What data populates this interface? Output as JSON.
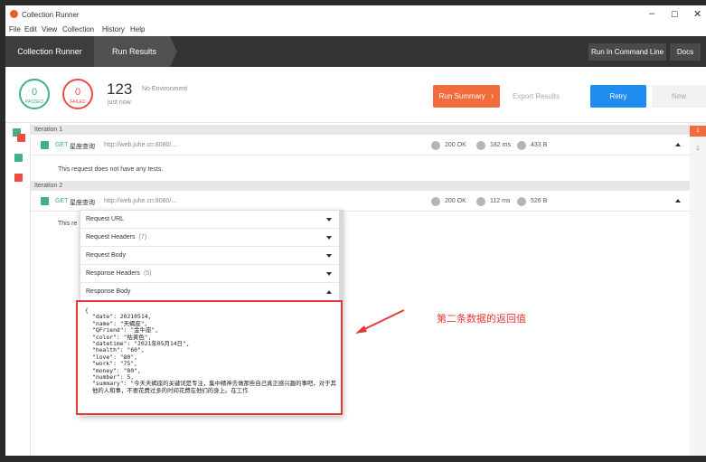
{
  "window": {
    "title": "Collection Runner",
    "controls": {
      "minimize": "–",
      "maximize": "☐",
      "close": "✕"
    }
  },
  "menu": [
    "File",
    "Edit",
    "View",
    "Collection",
    "History",
    "Help"
  ],
  "tabs": {
    "runner": "Collection Runner",
    "results": "Run Results"
  },
  "toolbar": {
    "command_line": "Run In Command Line",
    "docs": "Docs"
  },
  "summary": {
    "passed_count": "0",
    "passed_label": "PASSED",
    "failed_count": "0",
    "failed_label": "FAILED",
    "total": "123",
    "when": "just now",
    "environment": "No Environment",
    "run_summary": "Run Summary",
    "export": "Export Results",
    "retry": "Retry",
    "new": "New"
  },
  "iterations": [
    {
      "header": "Iteration 1",
      "method": "GET",
      "name": "星座查询",
      "url": "http://web.juhe.cn:8080/...",
      "status": "200 OK",
      "time": "182 ms",
      "size": "433 B",
      "note": "This request does not have any tests."
    },
    {
      "header": "Iteration 2",
      "method": "GET",
      "name": "星座查询",
      "url": "http://web.juhe.cn:8080/...",
      "status": "200 OK",
      "time": "112 ms",
      "size": "526 B",
      "note": "This re"
    }
  ],
  "dropdown": {
    "request_url": "Request URL",
    "request_headers": "Request Headers",
    "request_headers_count": "(7)",
    "request_body": "Request Body",
    "response_headers": "Response Headers",
    "response_headers_count": "(5)",
    "response_body": "Response Body"
  },
  "response_json": {
    "open": "{",
    "lines": [
      "\"date\": 20210514,",
      "\"name\": \"天蝎座\",",
      "\"QFriend\": \"金牛座\",",
      "\"color\": \"枯黄色\",",
      "\"datetime\": \"2021年05月14日\",",
      "\"health\": \"60\",",
      "\"love\": \"80\",",
      "\"work\": \"75\",",
      "\"money\": \"80\",",
      "\"number\": 5,"
    ],
    "summary": "\"summary\": \"今天天蝎座的关键词是专注，集中精神去做那些自己真正感兴趣的事吧，对于其他的人和事，不要花费过多的时间花费在他们的身上。在工作"
  },
  "rail": {
    "active": "1",
    "second": "2"
  },
  "annotation": "第二条数据的返回值",
  "colors": {
    "accent": "#f26b3a",
    "retry": "#1f8cf0",
    "pass": "#3fb27f",
    "fail": "#ed4b48",
    "highlight": "#e53935"
  }
}
